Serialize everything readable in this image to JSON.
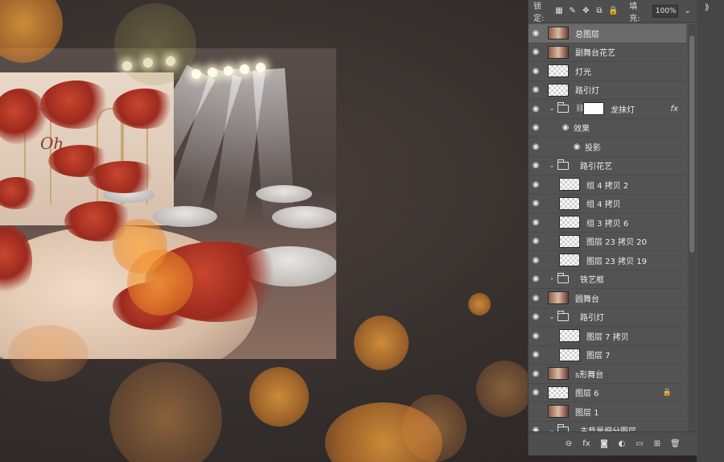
{
  "layers_panel": {
    "lock_label": "锁定:",
    "fill_label": "填充:",
    "fill_value": "100%",
    "layers": [
      {
        "name": "总图层",
        "type": "image",
        "visible": true,
        "selected": true
      },
      {
        "name": "副舞台花艺",
        "type": "image",
        "visible": true
      },
      {
        "name": "灯光",
        "type": "empty",
        "visible": true
      },
      {
        "name": "路引灯",
        "type": "empty",
        "visible": true
      },
      {
        "name": "龙抹灯",
        "type": "group-mask",
        "visible": true,
        "fx": "fx",
        "expanded": true
      },
      {
        "name": "效果",
        "type": "effect-header",
        "visible": true
      },
      {
        "name": "投影",
        "type": "effect",
        "visible": true
      },
      {
        "name": "路引花艺",
        "type": "group",
        "visible": true,
        "expanded": true
      },
      {
        "name": "组 4 拷贝 2",
        "type": "empty",
        "visible": true,
        "indent": true
      },
      {
        "name": "组 4 拷贝",
        "type": "empty",
        "visible": true,
        "indent": true
      },
      {
        "name": "组 3 拷贝 6",
        "type": "empty",
        "visible": true,
        "indent": true
      },
      {
        "name": "图层 23 拷贝 20",
        "type": "empty",
        "visible": true,
        "indent": true
      },
      {
        "name": "图层 23 拷贝 19",
        "type": "empty",
        "visible": true,
        "indent": true
      },
      {
        "name": "铁艺框",
        "type": "group",
        "visible": true,
        "expanded": false
      },
      {
        "name": "圆舞台",
        "type": "image",
        "visible": true
      },
      {
        "name": "路引灯",
        "type": "group",
        "visible": true,
        "expanded": true
      },
      {
        "name": "图层 7 拷贝",
        "type": "empty",
        "visible": true,
        "indent": true
      },
      {
        "name": "图层 7",
        "type": "empty",
        "visible": true,
        "indent": true
      },
      {
        "name": "s形舞台",
        "type": "image",
        "visible": true
      },
      {
        "name": "图层 6",
        "type": "empty",
        "visible": true,
        "locked": true
      },
      {
        "name": "图层 1",
        "type": "image",
        "visible": false
      },
      {
        "name": "主背景细分图层",
        "type": "group",
        "visible": true,
        "expanded": true
      }
    ],
    "footer_icons": [
      "link-icon",
      "fx-icon",
      "mask-icon",
      "adjustment-icon",
      "folder-icon",
      "new-layer-icon",
      "trash-icon"
    ],
    "footer_glyphs": [
      "⊖",
      "fx",
      "◙",
      "◐",
      "▭",
      "⊞",
      "🗑"
    ]
  },
  "artwork": {
    "script_text": "Oh"
  },
  "colors": {
    "bokeh": "#f0a040",
    "panel_bg": "#535353",
    "selected_row": "#6b6b6b"
  }
}
